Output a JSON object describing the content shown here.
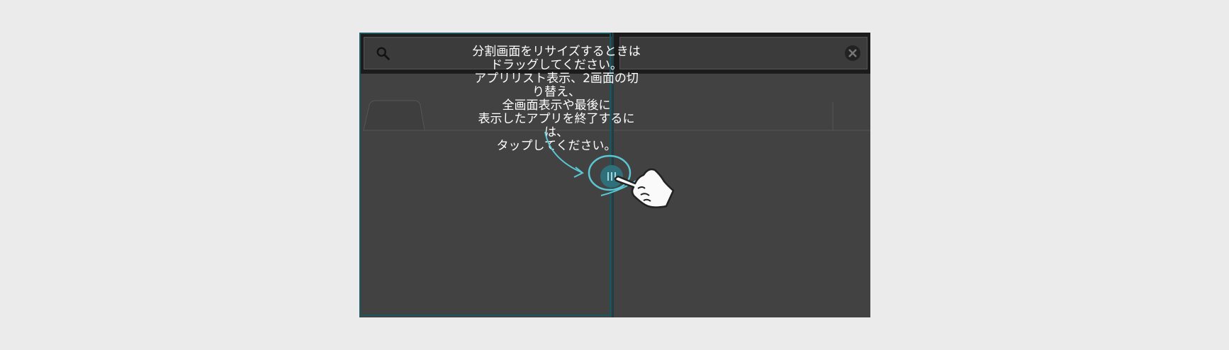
{
  "overlay": {
    "instruction": "分割画面をリサイズするときは\nドラッグしてください。\nアプリリスト表示、2画面の切り替え、\n全画面表示や最後に\n表示したアプリを終了するには、\nタップしてください。"
  },
  "icons": {
    "search": "search-icon",
    "close": "close-icon",
    "handle": "split-handle-icon",
    "hand": "pointing-hand-icon",
    "arrow": "curved-arrow-icon"
  },
  "colors": {
    "accent": "#4fc3d1",
    "device_bg": "#424242",
    "topbar_bg": "#1c1c1c"
  }
}
